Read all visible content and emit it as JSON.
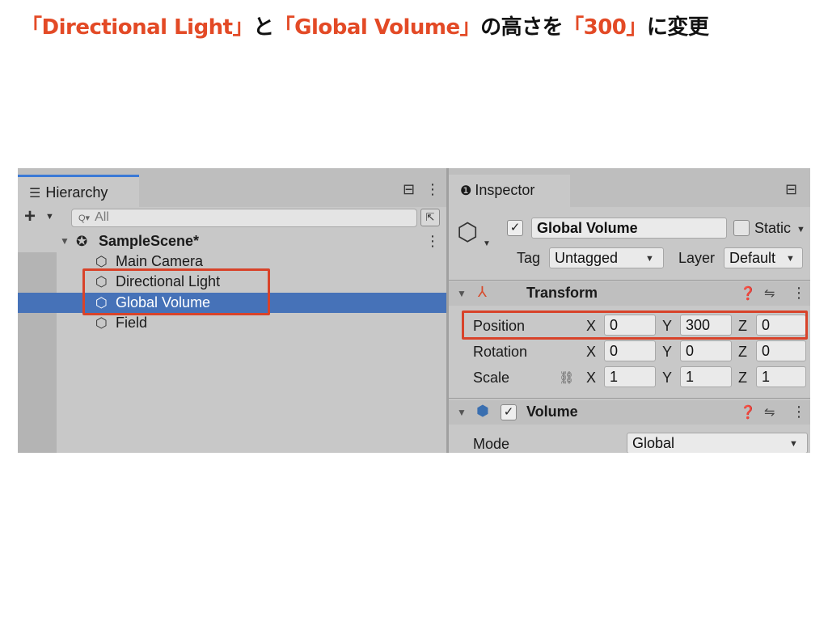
{
  "instruction": {
    "segments": [
      {
        "text": "「Directional Light」",
        "red": true
      },
      {
        "text": "と",
        "red": false
      },
      {
        "text": "「Global Volume」",
        "red": true
      },
      {
        "text": "の高さを",
        "red": false
      },
      {
        "text": "「300」",
        "red": true
      },
      {
        "text": "に変更",
        "red": false
      }
    ]
  },
  "hierarchy": {
    "tab_label": "Hierarchy",
    "tab_icon": "☰",
    "lock_icon": "⊟",
    "menu_icon": "⋮",
    "add_icon": "+",
    "add_caret": "▼",
    "search_icon": "Q▾",
    "search_placeholder": "All",
    "expand_icon": "⇱",
    "scene": {
      "caret": "▼",
      "icon": "✪",
      "label": "SampleScene*",
      "menu": "⋮"
    },
    "items": [
      {
        "label": "Main Camera",
        "icon": "⬡",
        "selected": false
      },
      {
        "label": "Directional Light",
        "icon": "⬡",
        "selected": false
      },
      {
        "label": "Global Volume",
        "icon": "⬡",
        "selected": true
      },
      {
        "label": "Field",
        "icon": "⬡",
        "selected": false
      }
    ]
  },
  "inspector": {
    "tab_label": "Inspector",
    "tab_icon": "❶",
    "lock_icon": "⊟",
    "gameobject": {
      "icon": "⬡",
      "active_checked": "✓",
      "name": "Global Volume",
      "static_label": "Static",
      "static_caret": "▼",
      "tag_label": "Tag",
      "tag_value": "Untagged",
      "layer_label": "Layer",
      "layer_value": "Default",
      "caret": "▼"
    },
    "transform": {
      "caret": "▼",
      "icon": "⅄",
      "title": "Transform",
      "help_icon": "❓",
      "preset_icon": "⇋",
      "menu_icon": "⋮",
      "rows": [
        {
          "label": "Position",
          "x": "0",
          "y": "300",
          "z": "0"
        },
        {
          "label": "Rotation",
          "x": "0",
          "y": "0",
          "z": "0"
        },
        {
          "label": "Scale",
          "x": "1",
          "y": "1",
          "z": "1"
        }
      ],
      "axis_x": "X",
      "axis_y": "Y",
      "axis_z": "Z",
      "scale_link_icon": "⛓"
    },
    "volume": {
      "caret": "▼",
      "icon": "⬢",
      "checked": "✓",
      "title": "Volume",
      "help_icon": "❓",
      "preset_icon": "⇋",
      "menu_icon": "⋮",
      "mode_label": "Mode",
      "mode_value": "Global",
      "mode_caret": "▼"
    }
  },
  "colors": {
    "highlight_red": "#e34a26",
    "selection_blue": "#4672b8"
  }
}
